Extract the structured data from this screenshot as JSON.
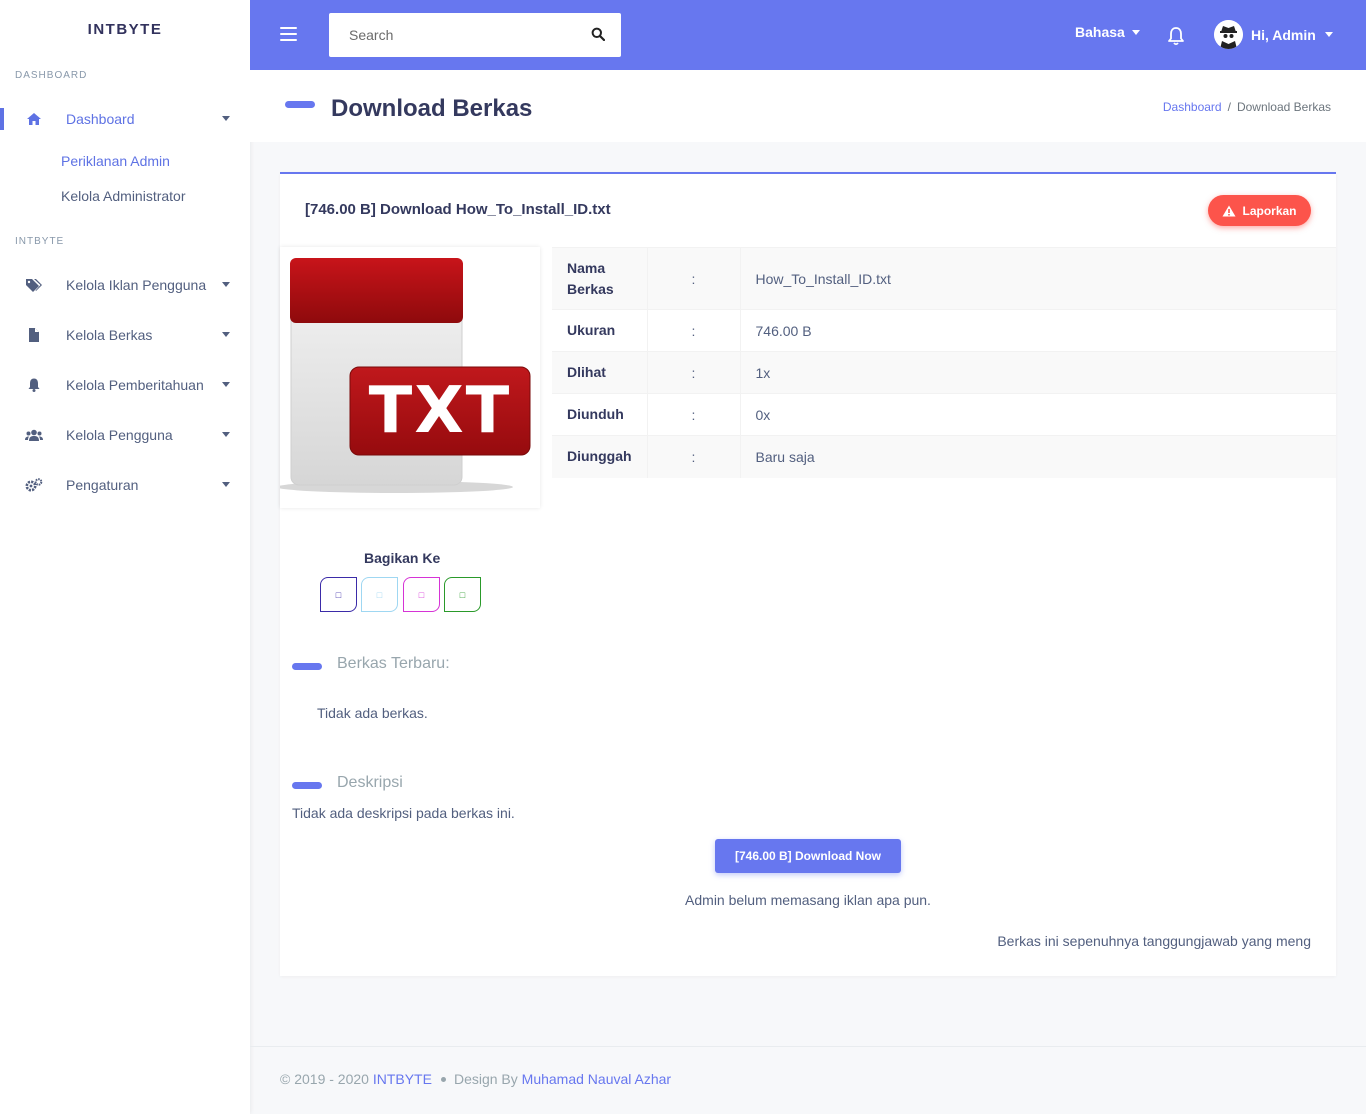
{
  "sidebar": {
    "brand": "INTBYTE",
    "section_dashboard": "DASHBOARD",
    "dashboard_label": "Dashboard",
    "sub_items": [
      "Periklanan Admin",
      "Kelola Administrator"
    ],
    "section_intbyte": "INTBYTE",
    "items": [
      {
        "label": "Kelola Iklan Pengguna",
        "icon": "tags-icon"
      },
      {
        "label": "Kelola Berkas",
        "icon": "file-icon"
      },
      {
        "label": "Kelola Pemberitahuan",
        "icon": "bell-icon"
      },
      {
        "label": "Kelola Pengguna",
        "icon": "users-icon"
      },
      {
        "label": "Pengaturan",
        "icon": "cogs-icon"
      }
    ]
  },
  "topbar": {
    "search_placeholder": "Search",
    "language_label": "Bahasa",
    "user_greeting": "Hi, Admin"
  },
  "page": {
    "title": "Download Berkas",
    "breadcrumb": [
      "Dashboard",
      "Download Berkas"
    ]
  },
  "card": {
    "title": "[746.00 B] Download How_To_Install_ID.txt",
    "report_label": "Laporkan",
    "file_badge": "TXT",
    "info": [
      {
        "key": "Nama Berkas",
        "sep": ":",
        "value": "How_To_Install_ID.txt"
      },
      {
        "key": "Ukuran",
        "sep": ":",
        "value": "746.00 B"
      },
      {
        "key": "Dlihat",
        "sep": ":",
        "value": "1x"
      },
      {
        "key": "Diunduh",
        "sep": ":",
        "value": "0x"
      },
      {
        "key": "Diunggah",
        "sep": ":",
        "value": "Baru saja"
      }
    ],
    "share_title": "Bagikan Ke",
    "share_buttons": [
      {
        "name": "facebook",
        "color": "#3b2ba8"
      },
      {
        "name": "twitter",
        "color": "#9fd7f2"
      },
      {
        "name": "instagram",
        "color": "#d633d6"
      },
      {
        "name": "whatsapp",
        "color": "#2a9a2a"
      }
    ],
    "recent_title": "Berkas Terbaru:",
    "recent_empty": "Tidak ada berkas.",
    "description_title": "Deskripsi",
    "description_empty": "Tidak ada deskripsi pada berkas ini.",
    "download_label": "[746.00 B] Download Now",
    "ad_text": "Admin belum memasang iklan apa pun.",
    "disclaimer": "Berkas ini sepenuhnya tanggungjawab yang meng"
  },
  "footer": {
    "copyright": "© 2019 - 2020",
    "brand_link": "INTBYTE",
    "design_by": "Design By",
    "author": "Muhamad Nauval Azhar"
  },
  "colors": {
    "accent": "#6777ef",
    "danger": "#fc544b"
  }
}
